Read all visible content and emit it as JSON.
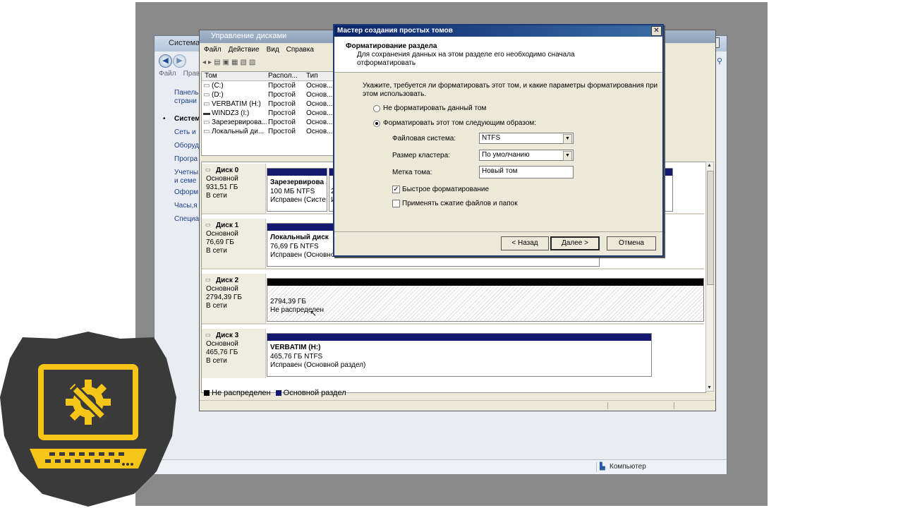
{
  "control_panel": {
    "title": "Система",
    "menu": [
      "Файл",
      "Прав"
    ],
    "sidebar": [
      "Панель",
      "страни",
      "Систем",
      "Сеть и",
      "Оборуд",
      "Програ",
      "Учетны",
      "и семе",
      "Оформ",
      "Часы,я",
      "Специа"
    ],
    "status": "Компьютер",
    "buttons": {
      "minimize": "_",
      "maximize": "□",
      "close": "✕"
    }
  },
  "disk_mgmt": {
    "title": "Управление дисками",
    "menu": [
      "Файл",
      "Действие",
      "Вид",
      "Справка"
    ],
    "columns": [
      "Том",
      "Распол...",
      "Тип"
    ],
    "volumes": [
      {
        "name": "(C:)",
        "layout": "Простой",
        "type": "Основ..."
      },
      {
        "name": "(D:)",
        "layout": "Простой",
        "type": "Основ..."
      },
      {
        "name": "VERBATIM (H:)",
        "layout": "Простой",
        "type": "Основ..."
      },
      {
        "name": "WINDZ3 (I:)",
        "layout": "Простой",
        "type": "Основ..."
      },
      {
        "name": "Зарезервирова...",
        "layout": "Простой",
        "type": "Основ..."
      },
      {
        "name": "Локальный ди...",
        "layout": "Простой",
        "type": "Основ..."
      }
    ],
    "disks": [
      {
        "name": "Диск 0",
        "kind": "Основной",
        "size": "931,51 ГБ",
        "state": "В сети",
        "parts": [
          {
            "title": "Зарезервирова",
            "fs": "100 МБ NTFS",
            "status": "Исправен (Систе"
          },
          {
            "title": "",
            "fs": "2",
            "status": "И"
          }
        ]
      },
      {
        "name": "Диск 1",
        "kind": "Основной",
        "size": "76,69 ГБ",
        "state": "В сети",
        "parts": [
          {
            "title": "Локальный диск",
            "fs": "76,69 ГБ NTFS",
            "status": "Исправен (Основной"
          }
        ]
      },
      {
        "name": "Диск 2",
        "kind": "Основной",
        "size": "2794,39 ГБ",
        "state": "В сети",
        "parts": [
          {
            "title": "",
            "fs": "2794,39 ГБ",
            "status": "Не распределен"
          }
        ]
      },
      {
        "name": "Диск 3",
        "kind": "Основной",
        "size": "465,76 ГБ",
        "state": "В сети",
        "parts": [
          {
            "title": "VERBATIM  (H:)",
            "fs": "465,76 ГБ NTFS",
            "status": "Исправен (Основной раздел)"
          }
        ]
      }
    ],
    "legend": [
      "Не распределен",
      "Основной раздел"
    ],
    "colors": {
      "unallocated": "#000000",
      "primary": "#14186e"
    }
  },
  "wizard": {
    "title": "Мастер создания простых томов",
    "heading": "Форматирование раздела",
    "subheading": "Для сохранения данных на этом разделе его необходимо сначала отформатировать",
    "prompt": "Укажите, требуется ли форматировать этот том, и какие параметры форматирования при этом использовать.",
    "option_no_format": "Не форматировать данный том",
    "option_format": "Форматировать этот том следующим образом:",
    "fs_label": "Файловая система:",
    "fs_value": "NTFS",
    "cluster_label": "Размер кластера:",
    "cluster_value": "По умолчанию",
    "volume_label_label": "Метка тома:",
    "volume_label_value": "Новый том",
    "quick_format": "Быстрое форматирование",
    "quick_format_checked": true,
    "compression": "Применять сжатие файлов и папок",
    "compression_checked": false,
    "back": "< Назад",
    "next": "Далее >",
    "cancel": "Отмена",
    "close": "✕"
  },
  "logo_colors": {
    "shield": "#3a3a3a",
    "laptop": "#f5c518"
  }
}
